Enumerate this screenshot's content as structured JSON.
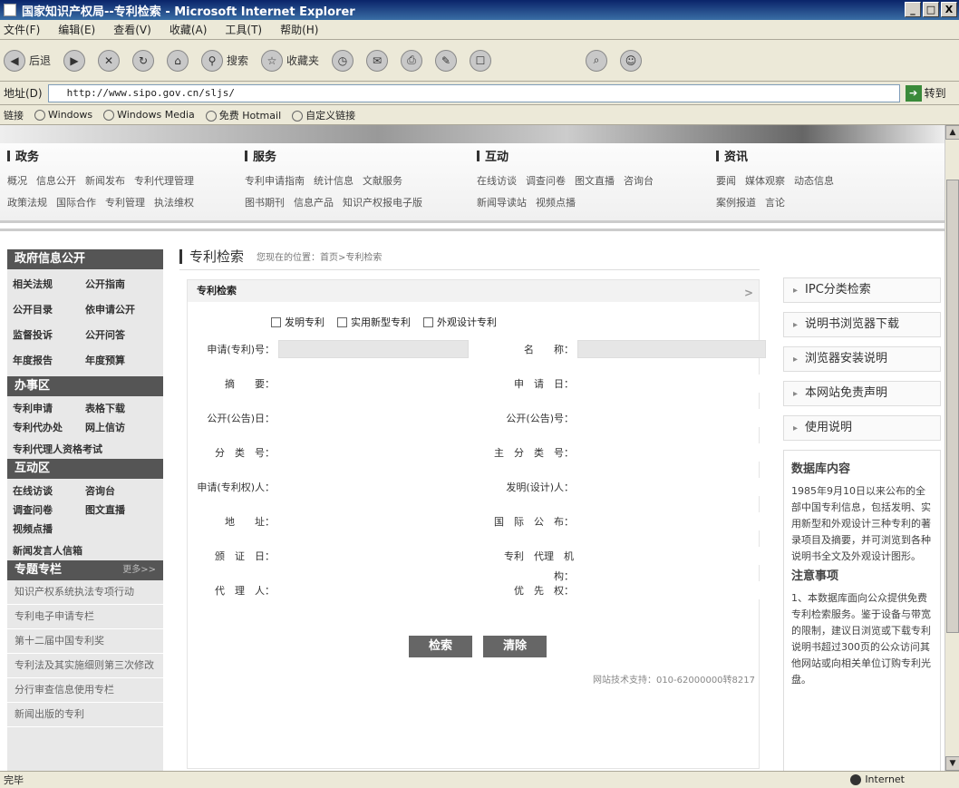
{
  "window": {
    "title": "国家知识产权局--专利检索 - Microsoft Internet Explorer",
    "controls": [
      "_",
      "□",
      "X"
    ]
  },
  "menu": [
    "文件(F)",
    "编辑(E)",
    "查看(V)",
    "收藏(A)",
    "工具(T)",
    "帮助(H)"
  ],
  "toolbar": {
    "back": "后退",
    "search": "搜索",
    "favorites": "收藏夹"
  },
  "address": {
    "label": "地址(D)",
    "url": "http://www.sipo.gov.cn/sljs/",
    "go": "转到"
  },
  "links": {
    "label": "链接",
    "items": [
      "Windows",
      "Windows Media",
      "免费 Hotmail",
      "自定义链接"
    ]
  },
  "site_nav": [
    {
      "head": "政务",
      "rows": [
        [
          "概况",
          "信息公开",
          "新闻发布",
          "专利代理管理"
        ],
        [
          "政策法规",
          "国际合作",
          "专利管理",
          "执法维权"
        ]
      ]
    },
    {
      "head": "服务",
      "rows": [
        [
          "专利申请指南",
          "统计信息",
          "文献服务"
        ],
        [
          "图书期刊",
          "信息产品",
          "知识产权报电子版"
        ]
      ]
    },
    {
      "head": "互动",
      "rows": [
        [
          "在线访谈",
          "调查问卷",
          "图文直播",
          "咨询台"
        ],
        [
          "新闻导读站",
          "视频点播"
        ]
      ]
    },
    {
      "head": "资讯",
      "rows": [
        [
          "要闻",
          "媒体观察",
          "动态信息"
        ],
        [
          "案例报道",
          "言论"
        ]
      ]
    }
  ],
  "left_panel": {
    "gov_info": {
      "title": "政府信息公开",
      "items": [
        "相关法规",
        "公开指南",
        "公开目录",
        "依申请公开",
        "监督投诉",
        "公开问答",
        "年度报告",
        "年度预算"
      ]
    },
    "office": {
      "title": "办事区",
      "items": [
        "专利申请",
        "表格下载",
        "专利代办处",
        "网上信访"
      ],
      "extra": "专利代理人资格考试"
    },
    "interact": {
      "title": "互动区",
      "items": [
        "在线访谈",
        "咨询台",
        "调查问卷",
        "图文直播",
        "视频点播"
      ],
      "extra": "新闻发言人信箱"
    },
    "topics": {
      "title": "专题专栏",
      "more": "更多>>",
      "items": [
        "知识产权系统执法专项行动",
        "专利电子申请专栏",
        "第十二届中国专利奖",
        "专利法及其实施细则第三次修改",
        "分行审查信息使用专栏",
        "新闻出版的专利"
      ]
    }
  },
  "main": {
    "title": "专利检索",
    "breadcrumb": "您现在的位置：首页>专利检索",
    "form_title": "专利检索",
    "form_chevron": ">",
    "checkboxes": [
      "发明专利",
      "实用新型专利",
      "外观设计专利"
    ],
    "fields_left": [
      "申请(专利)号：",
      "摘　　要：",
      "公开(公告)日：",
      "分　类　号：",
      "申请(专利权)人：",
      "地　　址：",
      "颁　证　日：",
      "代　理　人："
    ],
    "fields_right": [
      "名　　称：",
      "申　请　日：",
      "公开(公告)号：",
      "主　分　类　号：",
      "发明(设计)人：",
      "国　际　公　布：",
      "专利　代理　机构：",
      "优　先　权："
    ],
    "search_btn": "检索",
    "clear_btn": "清除",
    "support": "网站技术支持：010-62000000转8217"
  },
  "right_panel": {
    "buttons": [
      "IPC分类检索",
      "说明书浏览器下载",
      "浏览器安装说明",
      "本网站免责声明",
      "使用说明"
    ],
    "db_title": "数据库内容",
    "db_text": "1985年9月10日以来公布的全部中国专利信息，包括发明、实用新型和外观设计三种专利的著录项目及摘要，并可浏览到各种说明书全文及外观设计图形。",
    "note_title": "注意事项",
    "note_text": "1、本数据库面向公众提供免费专利检索服务。鉴于设备与带宽的限制，建议日浏览或下载专利说明书超过300页的公众访问其他网站或向相关单位订购专利光盘。"
  },
  "status": {
    "text": "完毕",
    "zone": "Internet"
  }
}
